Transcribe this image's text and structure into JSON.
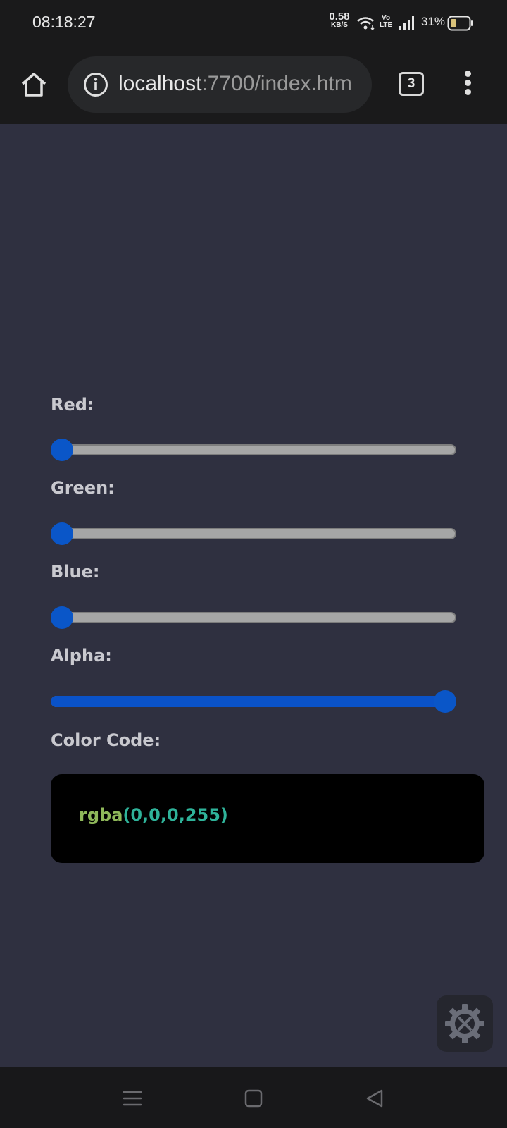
{
  "status_bar": {
    "time": "08:18:27",
    "net_speed_value": "0.58",
    "net_speed_unit": "KB/S",
    "volte_line1": "Vo",
    "volte_line2": "LTE",
    "battery": "31%"
  },
  "browser": {
    "url_host": "localhost",
    "url_rest": ":7700/index.htm",
    "tab_count": "3",
    "icons": [
      "home-icon",
      "info-icon",
      "tab-switcher-icon",
      "more-vert-icon"
    ]
  },
  "controls": {
    "red": {
      "label": "Red:",
      "value": 0,
      "min": 0,
      "max": 255
    },
    "green": {
      "label": "Green:",
      "value": 0,
      "min": 0,
      "max": 255
    },
    "blue": {
      "label": "Blue:",
      "value": 0,
      "min": 0,
      "max": 255
    },
    "alpha": {
      "label": "Alpha:",
      "value": 255,
      "min": 0,
      "max": 255
    }
  },
  "color_code": {
    "label": "Color Code:",
    "fn": "rgba",
    "args": "(0,0,0,255)"
  },
  "fab": {
    "icon": "tools-gear-icon"
  },
  "nav_bar": {
    "icons": [
      "recents-menu-icon",
      "home-square-icon",
      "back-triangle-icon"
    ]
  },
  "colors": {
    "background": "#2f3040",
    "slider_accent": "#0a56c8",
    "track": "#a6a6a6",
    "code_fn": "#8fb85a",
    "code_args": "#2fb39a"
  }
}
